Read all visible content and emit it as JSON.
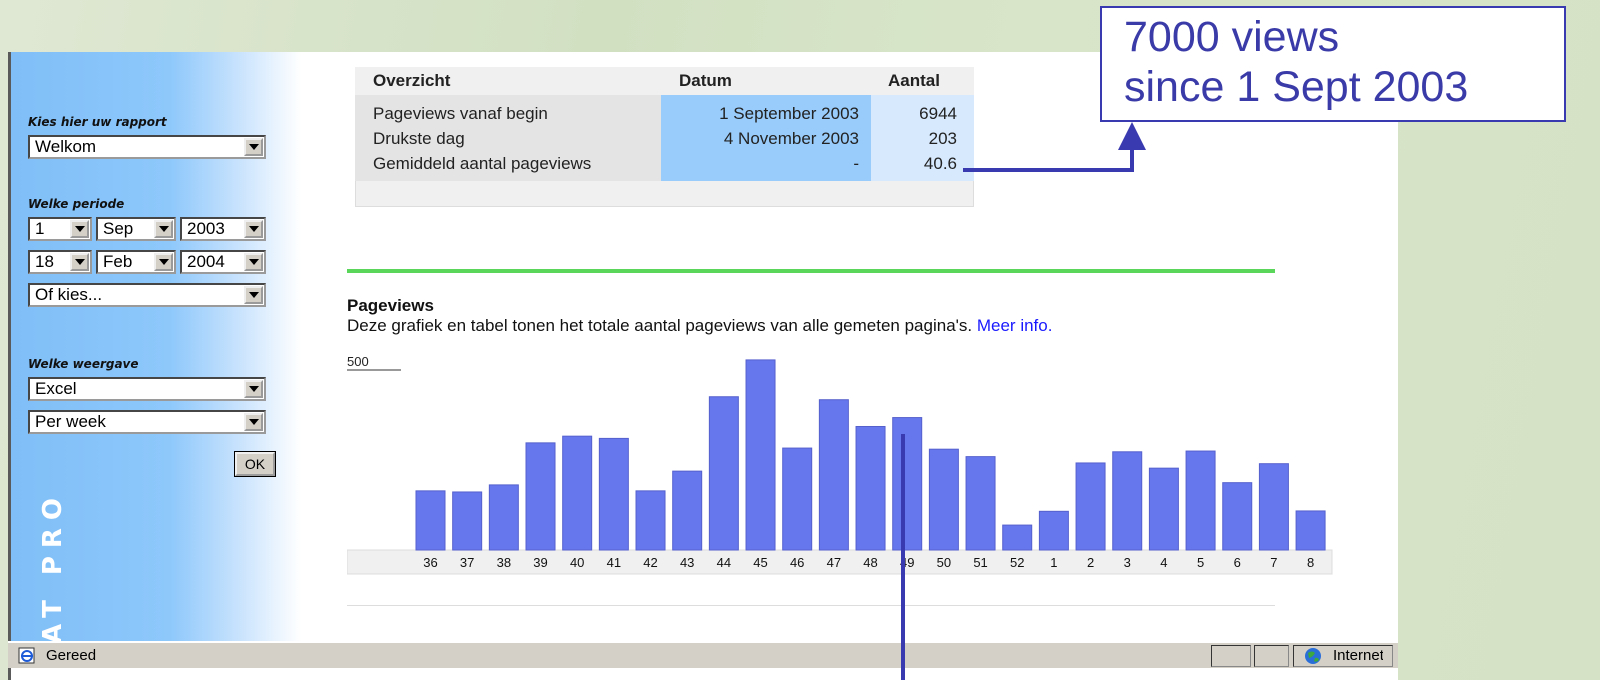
{
  "callout": {
    "line1": "7000 views",
    "line2": "since 1 Sept 2003"
  },
  "sidebar": {
    "report_label": "Kies hier uw rapport",
    "report_value": "Welkom",
    "period_label": "Welke periode",
    "start": {
      "day": "1",
      "month": "Sep",
      "year": "2003"
    },
    "end": {
      "day": "18",
      "month": "Feb",
      "year": "2004"
    },
    "preset_value": "Of kies...",
    "view_label": "Welke weergave",
    "view_value": "Excel",
    "interval_value": "Per week",
    "ok_label": "OK",
    "brand": "AT PRO"
  },
  "overview": {
    "headers": [
      "Overzicht",
      "Datum",
      "Aantal"
    ],
    "rows": [
      {
        "label": "Pageviews vanaf begin",
        "date": "1 September 2003",
        "count": "6944"
      },
      {
        "label": "Drukste dag",
        "date": "4 November 2003",
        "count": "203"
      },
      {
        "label": "Gemiddeld aantal pageviews",
        "date": "-",
        "count": "40.6"
      }
    ]
  },
  "pageviews": {
    "title": "Pageviews",
    "description": "Deze grafiek en tabel tonen het totale aantal pageviews van alle gemeten pagina's.",
    "more_info": "Meer info."
  },
  "chart_data": {
    "type": "bar",
    "color": "#6677ee",
    "scale_marker": 500,
    "categories": [
      "36",
      "37",
      "38",
      "39",
      "40",
      "41",
      "42",
      "43",
      "44",
      "45",
      "46",
      "47",
      "48",
      "49",
      "50",
      "51",
      "52",
      "1",
      "2",
      "3",
      "4",
      "5",
      "6",
      "7",
      "8"
    ],
    "values": [
      159,
      156,
      175,
      288,
      306,
      300,
      159,
      212,
      412,
      511,
      274,
      404,
      332,
      356,
      271,
      251,
      67,
      104,
      234,
      264,
      220,
      266,
      181,
      232,
      105
    ]
  },
  "statusbar": {
    "status": "Gereed",
    "zone": "Internet"
  },
  "colors": {
    "callout": "#3a3ab0",
    "bar": "#6677ee",
    "green_rule": "#5ad65a"
  }
}
